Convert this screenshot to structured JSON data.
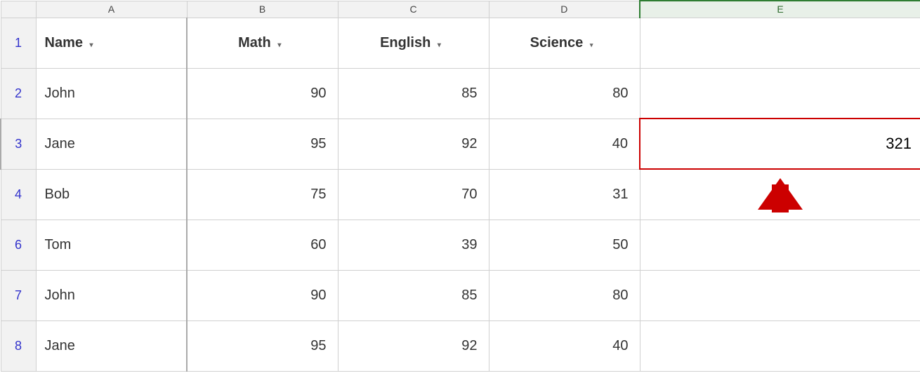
{
  "columns": {
    "row_header": "",
    "a": "A",
    "b": "B",
    "c": "C",
    "d": "D",
    "e": "E"
  },
  "header_row": {
    "row_num": "1",
    "name": "Name",
    "math": "Math",
    "english": "English",
    "science": "Science",
    "filter_arrow": "▾"
  },
  "rows": [
    {
      "row_num": "2",
      "name": "John",
      "math": "90",
      "english": "85",
      "science": "80"
    },
    {
      "row_num": "3",
      "name": "Jane",
      "math": "95",
      "english": "92",
      "science": "40",
      "e_value": "321"
    },
    {
      "row_num": "4",
      "name": "Bob",
      "math": "75",
      "english": "70",
      "science": "31"
    },
    {
      "row_num": "6",
      "name": "Tom",
      "math": "60",
      "english": "39",
      "science": "50"
    },
    {
      "row_num": "7",
      "name": "John",
      "math": "90",
      "english": "85",
      "science": "80"
    },
    {
      "row_num": "8",
      "name": "Jane",
      "math": "95",
      "english": "92",
      "science": "40"
    }
  ]
}
